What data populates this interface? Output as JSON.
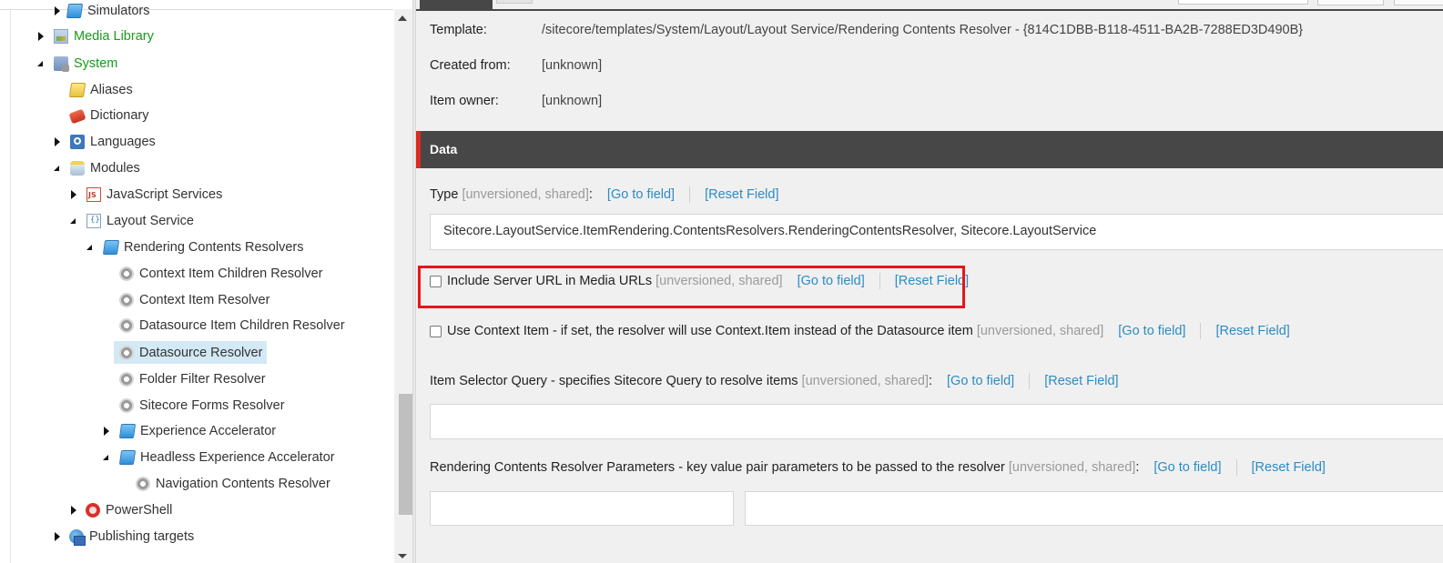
{
  "tree": {
    "nodes": [
      {
        "label": "Simulators",
        "icon": "simulators-icon",
        "state": "collapsed"
      },
      {
        "label": "Media Library",
        "icon": "media-library-icon",
        "state": "collapsed"
      },
      {
        "label": "System",
        "icon": "system-icon",
        "state": "expanded"
      },
      {
        "label": "Aliases",
        "icon": "folder-icon",
        "state": "leaf"
      },
      {
        "label": "Dictionary",
        "icon": "dictionary-icon",
        "state": "leaf"
      },
      {
        "label": "Languages",
        "icon": "languages-icon",
        "state": "collapsed"
      },
      {
        "label": "Modules",
        "icon": "modules-icon",
        "state": "expanded"
      },
      {
        "label": "JavaScript Services",
        "icon": "javascript-icon",
        "state": "collapsed"
      },
      {
        "label": "Layout Service",
        "icon": "layout-service-icon",
        "state": "expanded"
      },
      {
        "label": "Rendering Contents Resolvers",
        "icon": "folder-icon",
        "state": "expanded"
      },
      {
        "label": "Context Item Children Resolver",
        "icon": "gear-icon",
        "state": "leaf"
      },
      {
        "label": "Context Item Resolver",
        "icon": "gear-icon",
        "state": "leaf"
      },
      {
        "label": "Datasource Item Children Resolver",
        "icon": "gear-icon",
        "state": "leaf"
      },
      {
        "label": "Datasource Resolver",
        "icon": "gear-icon",
        "state": "leaf",
        "selected": true
      },
      {
        "label": "Folder Filter Resolver",
        "icon": "gear-icon",
        "state": "leaf"
      },
      {
        "label": "Sitecore Forms Resolver",
        "icon": "gear-icon",
        "state": "leaf"
      },
      {
        "label": "Experience Accelerator",
        "icon": "folder-icon",
        "state": "collapsed"
      },
      {
        "label": "Headless Experience Accelerator",
        "icon": "folder-icon",
        "state": "expanded"
      },
      {
        "label": "Navigation Contents Resolver",
        "icon": "gear-icon",
        "state": "leaf"
      },
      {
        "label": "PowerShell",
        "icon": "powershell-icon",
        "state": "collapsed"
      },
      {
        "label": "Publishing targets",
        "icon": "publishing-targets-icon",
        "state": "collapsed"
      }
    ]
  },
  "info": {
    "template_label": "Template:",
    "template_value": "/sitecore/templates/System/Layout/Layout Service/Rendering Contents Resolver - {814C1DBB-B118-4511-BA2B-7288ED3D490B}",
    "created_from_label": "Created from:",
    "created_from_value": "[unknown]",
    "item_owner_label": "Item owner:",
    "item_owner_value": "[unknown]"
  },
  "section": {
    "title": "Data",
    "accent_color": "#dc2a1f"
  },
  "fields": {
    "go_to_field": "[Go to field]",
    "reset_field": "[Reset Field]",
    "type": {
      "label": "Type",
      "meta": "[unversioned, shared]",
      "colon": ":",
      "value": "Sitecore.LayoutService.ItemRendering.ContentsResolvers.RenderingContentsResolver, Sitecore.LayoutService"
    },
    "include_server_url": {
      "label": "Include Server URL in Media URLs",
      "meta": "[unversioned, shared]",
      "checked": false,
      "highlighted": true
    },
    "use_context_item": {
      "label": "Use Context Item - if set, the resolver will use Context.Item instead of the Datasource item",
      "meta": "[unversioned, shared]",
      "checked": false
    },
    "item_selector_query": {
      "label": "Item Selector Query - specifies Sitecore Query to resolve items",
      "meta": "[unversioned, shared]",
      "colon": ":",
      "value": ""
    },
    "rendering_params": {
      "label": "Rendering Contents Resolver Parameters - key value pair parameters to be passed to the resolver",
      "meta": "[unversioned, shared]",
      "colon": ":",
      "key_value": "",
      "value_value": ""
    }
  }
}
